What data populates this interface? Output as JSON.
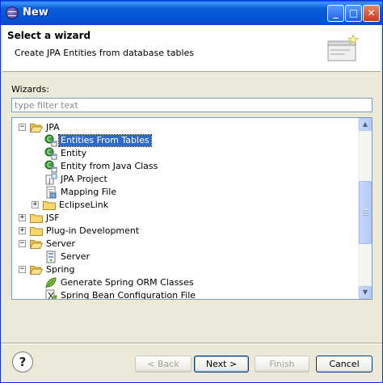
{
  "window": {
    "title": "New",
    "minimize": "_",
    "maximize": "□",
    "close": "✕"
  },
  "header": {
    "title": "Select a wizard",
    "description": "Create JPA Entities from database tables"
  },
  "wizards_label": "Wizards:",
  "filter": {
    "placeholder": "type filter text",
    "value": ""
  },
  "tree": [
    {
      "label": "JPA",
      "level": 0,
      "expander": "minus",
      "icon": "folder-open-icon"
    },
    {
      "label": "Entities From Tables",
      "level": 1,
      "icon": "jpa-entity-icon",
      "selected": true
    },
    {
      "label": "Entity",
      "level": 1,
      "icon": "jpa-entity-icon"
    },
    {
      "label": "Entity from Java Class",
      "level": 1,
      "icon": "jpa-entity-icon"
    },
    {
      "label": "JPA Project",
      "level": 1,
      "icon": "jpa-project-icon"
    },
    {
      "label": "Mapping File",
      "level": 1,
      "icon": "mapping-file-icon"
    },
    {
      "label": "EclipseLink",
      "level": 1,
      "expander": "plus",
      "icon": "folder-icon"
    },
    {
      "label": "JSF",
      "level": 0,
      "expander": "plus",
      "icon": "folder-icon"
    },
    {
      "label": "Plug-in Development",
      "level": 0,
      "expander": "plus",
      "icon": "folder-icon"
    },
    {
      "label": "Server",
      "level": 0,
      "expander": "minus",
      "icon": "folder-open-icon"
    },
    {
      "label": "Server",
      "level": 1,
      "icon": "server-icon"
    },
    {
      "label": "Spring",
      "level": 0,
      "expander": "minus",
      "icon": "folder-open-icon"
    },
    {
      "label": "Generate Spring ORM Classes",
      "level": 1,
      "icon": "spring-leaf-icon"
    },
    {
      "label": "Spring Bean Configuration File",
      "level": 1,
      "icon": "spring-bean-file-icon"
    }
  ],
  "buttons": {
    "help": "?",
    "back": "< Back",
    "next": "Next >",
    "finish": "Finish",
    "cancel": "Cancel"
  },
  "scrollbar": {
    "up": "▲",
    "down": "▼"
  }
}
